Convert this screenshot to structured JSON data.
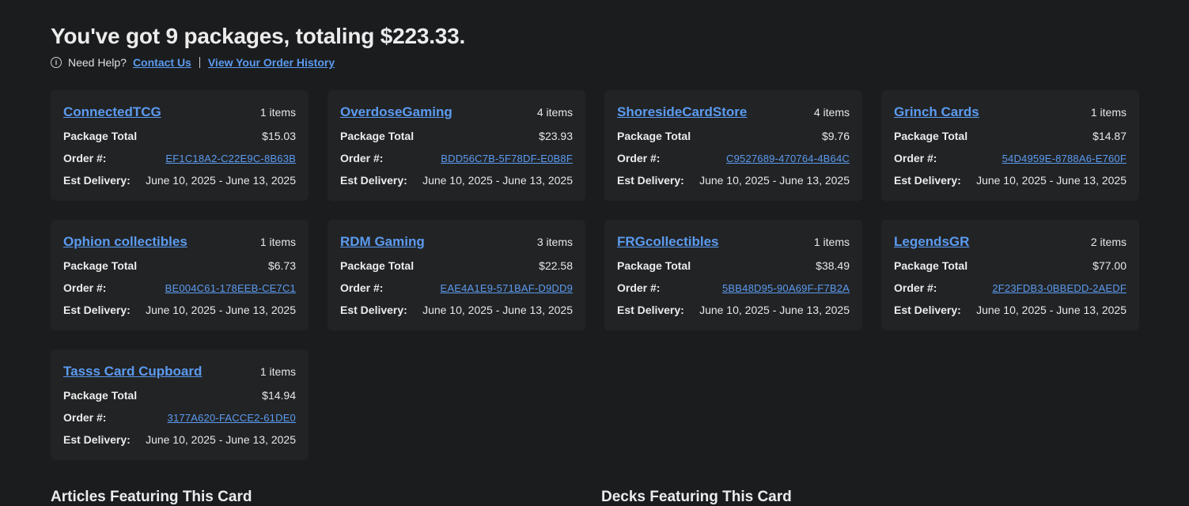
{
  "header": {
    "title": "You've got 9 packages, totaling $223.33.",
    "help_label": "Need Help?",
    "contact_link": "Contact Us",
    "history_link": "View Your Order History"
  },
  "labels": {
    "package_total": "Package Total",
    "order": "Order #:",
    "est_delivery": "Est Delivery:"
  },
  "packages": [
    {
      "seller": "ConnectedTCG",
      "items": "1 items",
      "total": "$15.03",
      "order": "EF1C18A2-C22E9C-8B63B",
      "delivery": "June 10, 2025 - June 13, 2025"
    },
    {
      "seller": "OverdoseGaming",
      "items": "4 items",
      "total": "$23.93",
      "order": "BDD56C7B-5F78DF-E0B8F",
      "delivery": "June 10, 2025 - June 13, 2025"
    },
    {
      "seller": "ShoresideCardStore",
      "items": "4 items",
      "total": "$9.76",
      "order": "C9527689-470764-4B64C",
      "delivery": "June 10, 2025 - June 13, 2025"
    },
    {
      "seller": "Grinch Cards",
      "items": "1 items",
      "total": "$14.87",
      "order": "54D4959E-8788A6-E760F",
      "delivery": "June 10, 2025 - June 13, 2025"
    },
    {
      "seller": "Ophion collectibles",
      "items": "1 items",
      "total": "$6.73",
      "order": "BE004C61-178EEB-CE7C1",
      "delivery": "June 10, 2025 - June 13, 2025"
    },
    {
      "seller": "RDM Gaming",
      "items": "3 items",
      "total": "$22.58",
      "order": "EAE4A1E9-571BAF-D9DD9",
      "delivery": "June 10, 2025 - June 13, 2025"
    },
    {
      "seller": "FRGcollectibles",
      "items": "1 items",
      "total": "$38.49",
      "order": "5BB48D95-90A69F-F7B2A",
      "delivery": "June 10, 2025 - June 13, 2025"
    },
    {
      "seller": "LegendsGR",
      "items": "2 items",
      "total": "$77.00",
      "order": "2F23FDB3-0BBEDD-2AEDF",
      "delivery": "June 10, 2025 - June 13, 2025"
    },
    {
      "seller": "Tasss Card Cupboard",
      "items": "1 items",
      "total": "$14.94",
      "order": "3177A620-FACCE2-61DE0",
      "delivery": "June 10, 2025 - June 13, 2025"
    }
  ],
  "sections": {
    "articles_title": "Articles Featuring This Card",
    "decks_title": "Decks Featuring This Card"
  },
  "icons": {
    "info": "info-circle-icon"
  },
  "colors": {
    "background": "#1b1c1e",
    "card": "#222325",
    "link": "#5b9bf0"
  }
}
